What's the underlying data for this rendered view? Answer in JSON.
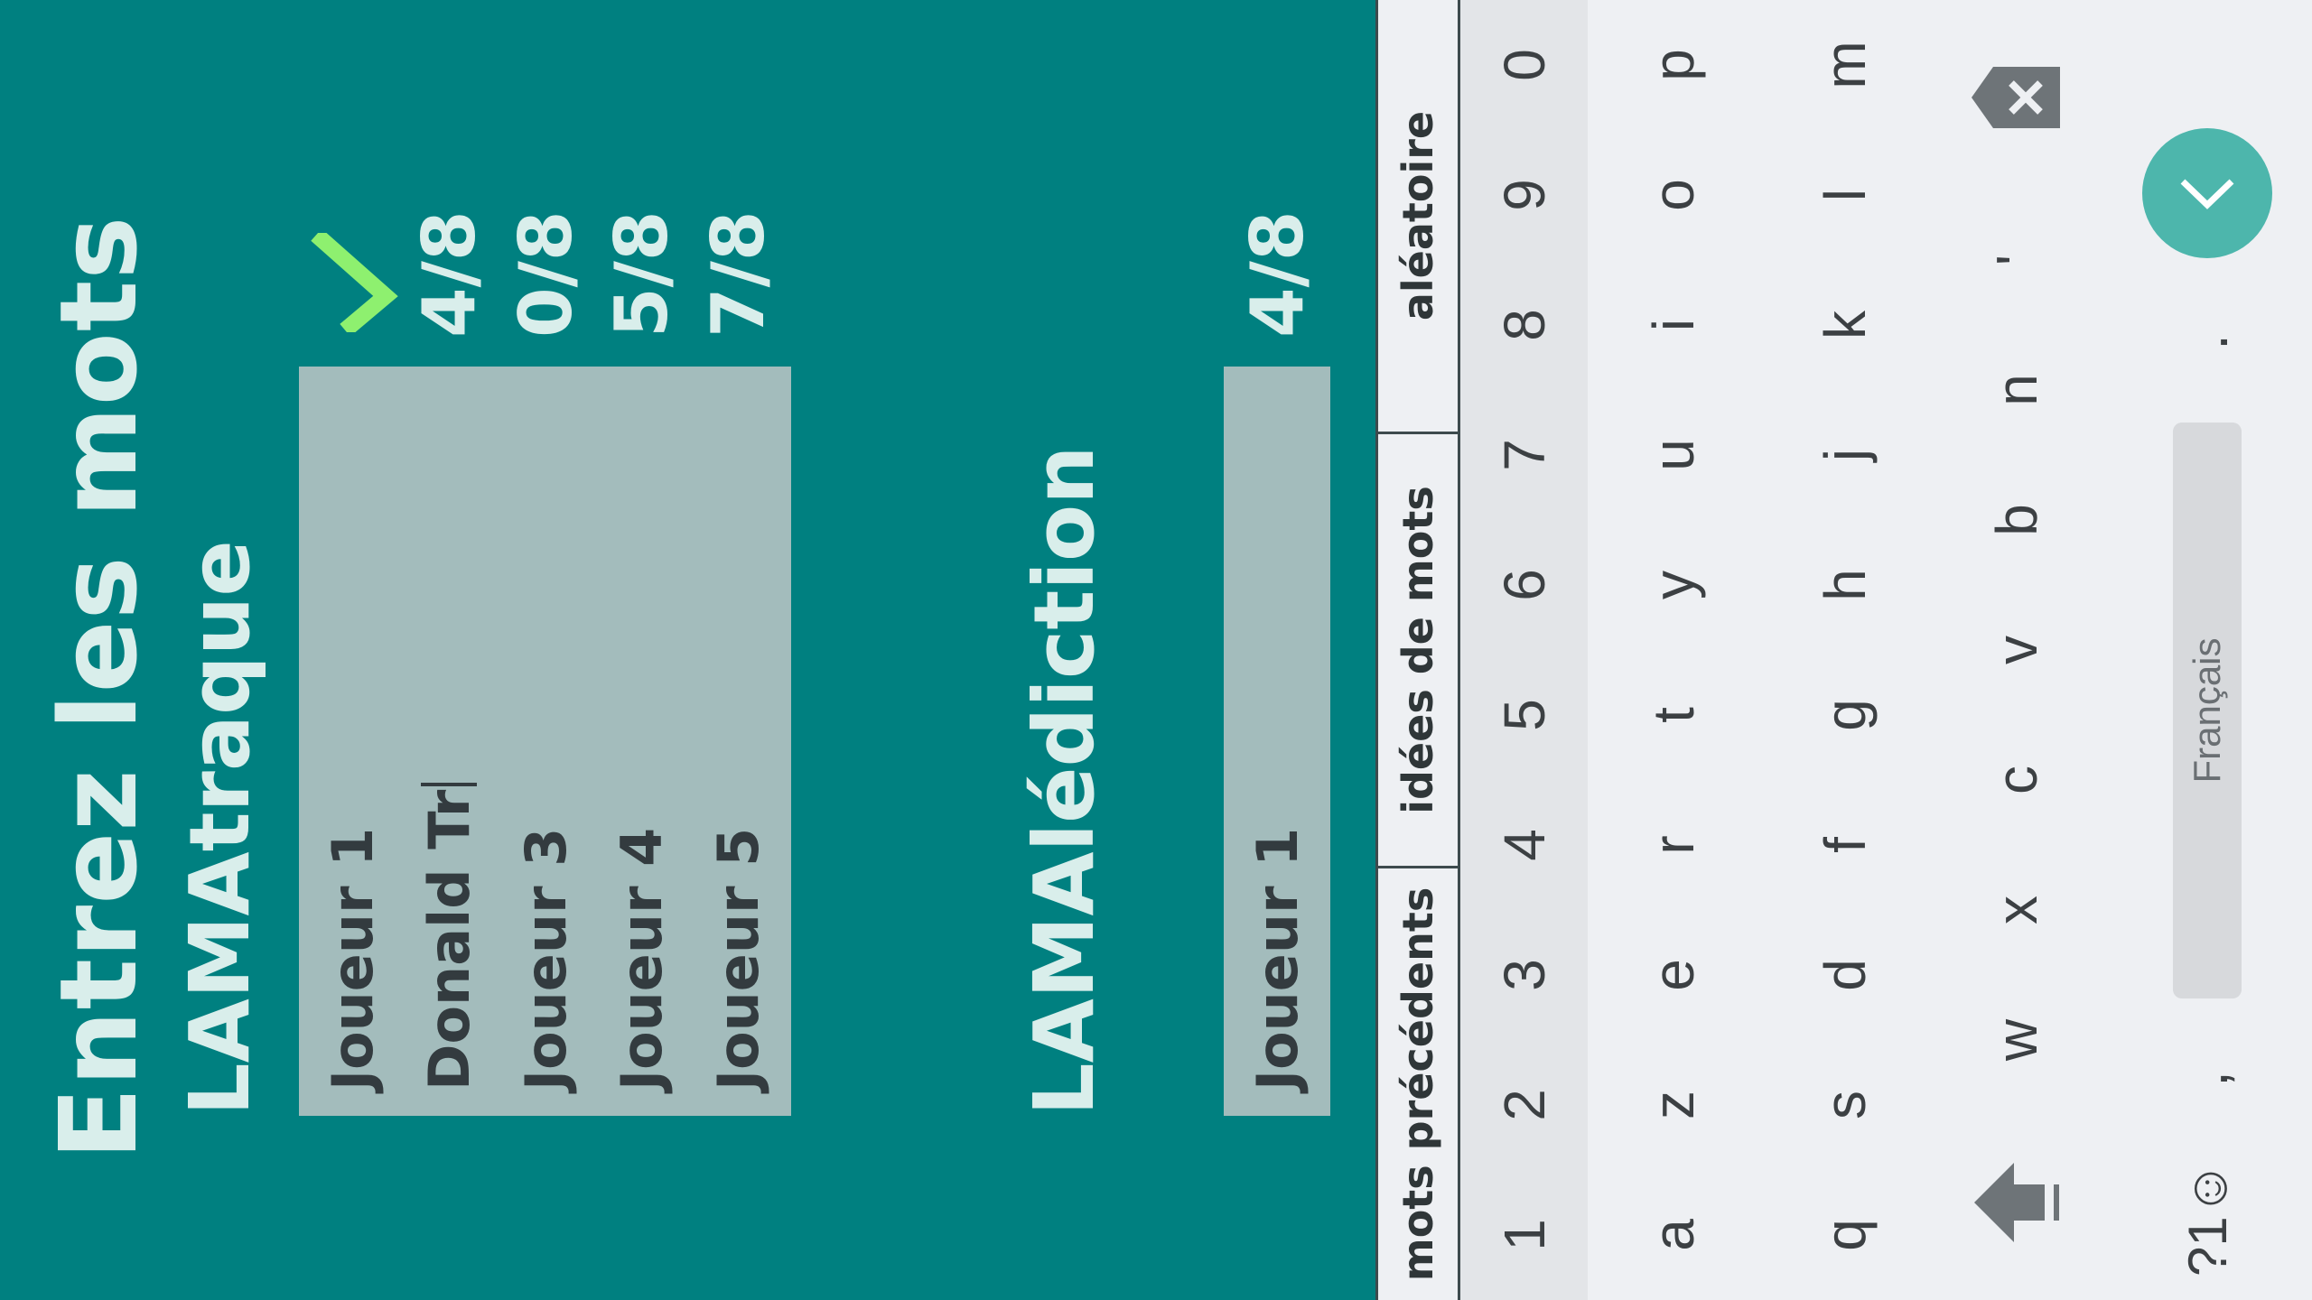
{
  "header": {
    "title": "Entrez les mots"
  },
  "sections": [
    {
      "name": "LAMAtraque",
      "rows": [
        {
          "value": "Joueur 1",
          "score": "",
          "status": "check-icon"
        },
        {
          "value": "Donald Tr",
          "score": "4/8"
        },
        {
          "value": "Joueur 3",
          "score": "0/8"
        },
        {
          "value": "Joueur 4",
          "score": "5/8"
        },
        {
          "value": "Joueur 5",
          "score": "7/8"
        }
      ]
    },
    {
      "name": "LAMAlédiction",
      "rows": [
        {
          "value": "Joueur 1",
          "score": "4/8"
        }
      ]
    }
  ],
  "suggestions": [
    "mots précédents",
    "idées de mots",
    "aléatoire"
  ],
  "keyboard": {
    "numbers": [
      "1",
      "2",
      "3",
      "4",
      "5",
      "6",
      "7",
      "8",
      "9",
      "0"
    ],
    "row1": [
      "a",
      "z",
      "e",
      "r",
      "t",
      "y",
      "u",
      "i",
      "o",
      "p"
    ],
    "row2": [
      "q",
      "s",
      "d",
      "f",
      "g",
      "h",
      "j",
      "k",
      "l",
      "m"
    ],
    "row3": [
      "w",
      "x",
      "c",
      "v",
      "b",
      "n",
      "'"
    ],
    "symbols_label": "?1☺",
    "comma": ",",
    "space_label": "Français",
    "period": "."
  },
  "colors": {
    "background": "#008080",
    "field": "#a3bcbc",
    "text": "#d9eeeb",
    "check": "#8ef06f",
    "fab": "#4db6ac"
  }
}
